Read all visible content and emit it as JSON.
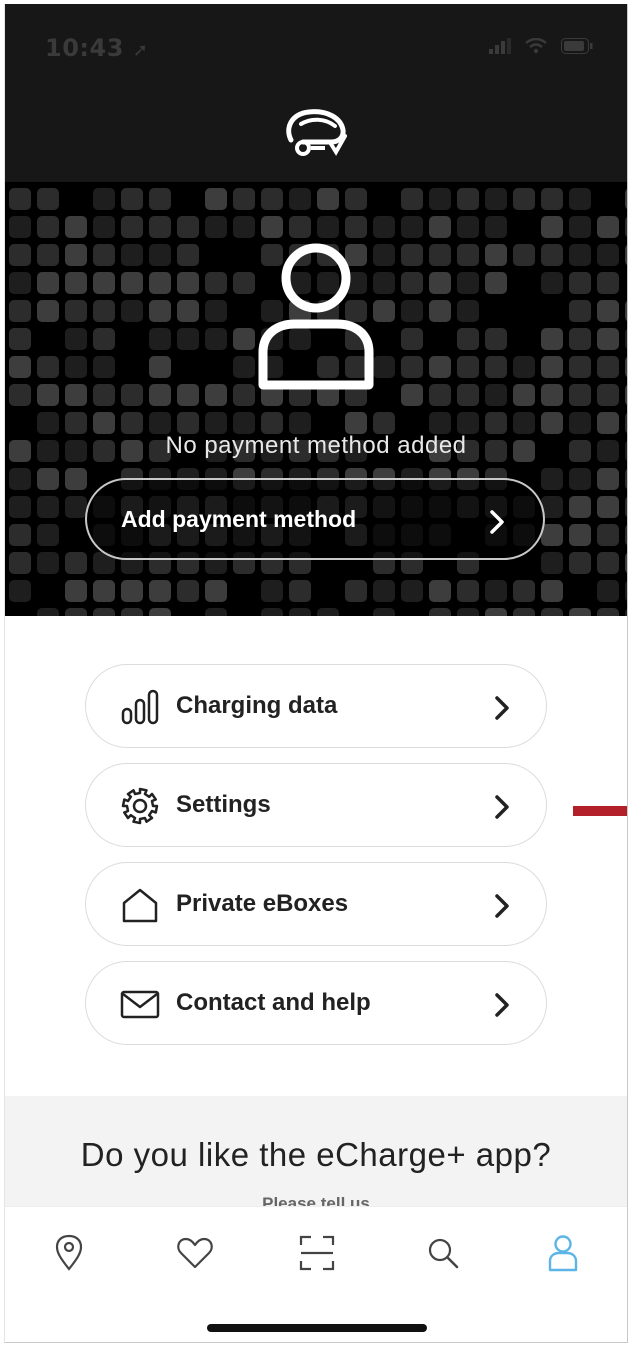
{
  "status_bar": {
    "time": "10:43",
    "time_icon": "location-arrow-icon"
  },
  "header": {
    "logo_icon": "echarge-car-plug-logo"
  },
  "profile": {
    "avatar_icon": "user-icon",
    "payment_status": "No payment method added",
    "add_payment_label": "Add payment method"
  },
  "menu": {
    "items": [
      {
        "label": "Charging data",
        "icon": "bar-chart-icon"
      },
      {
        "label": "Settings",
        "icon": "gear-icon"
      },
      {
        "label": "Private eBoxes",
        "icon": "house-icon"
      },
      {
        "label": "Contact and help",
        "icon": "envelope-icon"
      }
    ]
  },
  "feedback": {
    "question": "Do you like the eCharge+ app?",
    "subtitle": "Please tell us"
  },
  "tabbar": {
    "tabs": [
      {
        "icon": "map-pin-icon"
      },
      {
        "icon": "heart-icon"
      },
      {
        "icon": "scan-icon"
      },
      {
        "icon": "search-icon"
      },
      {
        "icon": "profile-icon",
        "active": true
      }
    ],
    "active_color": "#5bb5e6"
  },
  "colors": {
    "dark_bg": "#171717",
    "hero_bg": "#000000",
    "annotation_arrow": "#b3202a"
  }
}
